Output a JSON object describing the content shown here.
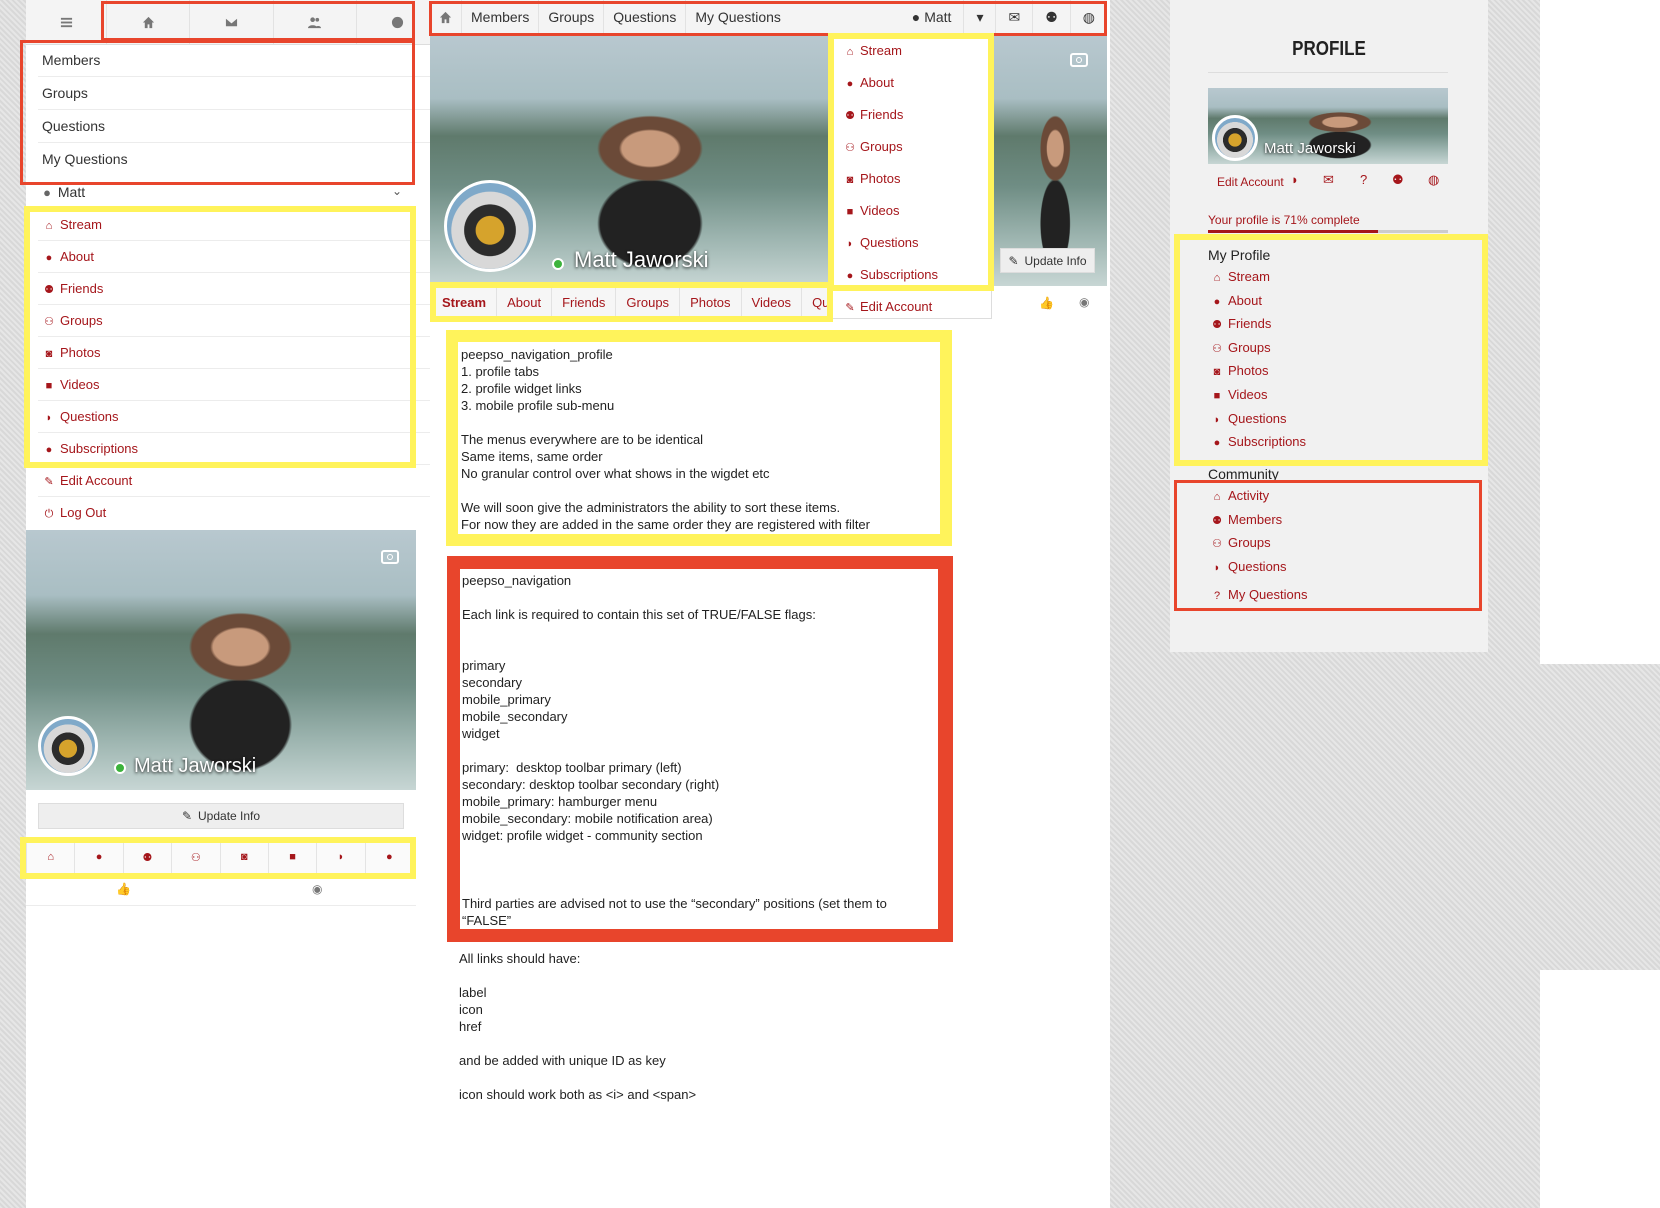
{
  "mobile": {
    "top_icons": [
      "bars-icon",
      "home-icon",
      "envelope-icon",
      "users-icon",
      "globe-icon"
    ],
    "menu": [
      "Members",
      "Groups",
      "Questions",
      "My Questions"
    ],
    "user_name": "Matt",
    "profile_nav": [
      "Stream",
      "About",
      "Friends",
      "Groups",
      "Photos",
      "Videos",
      "Questions",
      "Subscriptions"
    ],
    "account": [
      "Edit Account",
      "Log Out"
    ],
    "cover_name": "Matt Jaworski",
    "update_info": "Update Info"
  },
  "desktop": {
    "toolbar": [
      "Members",
      "Groups",
      "Questions",
      "My Questions"
    ],
    "user_name": "Matt",
    "dropdown": [
      "Stream",
      "About",
      "Friends",
      "Groups",
      "Photos",
      "Videos",
      "Questions",
      "Subscriptions"
    ],
    "edit_account": "Edit Account",
    "cover_name": "Matt Jaworski",
    "update_info": "Update Info",
    "tabs": [
      "Stream",
      "About",
      "Friends",
      "Groups",
      "Photos",
      "Videos",
      "Questio"
    ]
  },
  "notes": {
    "yellow": "peepso_navigation_profile\n1. profile tabs\n2. profile widget links\n3. mobile profile sub-menu\n\nThe menus everywhere are to be identical\nSame items, same order\nNo granular control over what shows in the wigdet etc\n\nWe will soon give the administrators the ability to sort these items.\nFor now they are added in the same order they are registered with filter",
    "red": "peepso_navigation\n\nEach link is required to contain this set of TRUE/FALSE flags:\n\n\nprimary\nsecondary\nmobile_primary\nmobile_secondary\nwidget\n\nprimary:  desktop toolbar primary (left)\nsecondary: desktop toolbar secondary (right)\nmobile_primary: hamburger menu\nmobile_secondary: mobile notification area)\nwidget: profile widget - community section\n\n\n\nThird parties are advised not to use the “secondary” positions (set them to\n“FALSE”",
    "footer": "All links should have:\n\nlabel\nicon\nhref\n\nand be added with unique ID as key\n\nicon should work both as <i> and <span>"
  },
  "widget": {
    "title": "PROFILE",
    "cover_name": "Matt Jaworski",
    "edit_account": "Edit Account",
    "completion": "Your profile is 71% complete",
    "completion_pct": 71,
    "my_profile_heading": "My Profile",
    "my_profile": [
      "Stream",
      "About",
      "Friends",
      "Groups",
      "Photos",
      "Videos",
      "Questions",
      "Subscriptions"
    ],
    "community_heading": "Community",
    "community": [
      "Activity",
      "Members",
      "Groups",
      "Questions",
      "My Questions"
    ]
  },
  "colors": {
    "accent": "#a5161b",
    "highlight_red": "#e8452c",
    "highlight_yellow": "#fff35b"
  }
}
